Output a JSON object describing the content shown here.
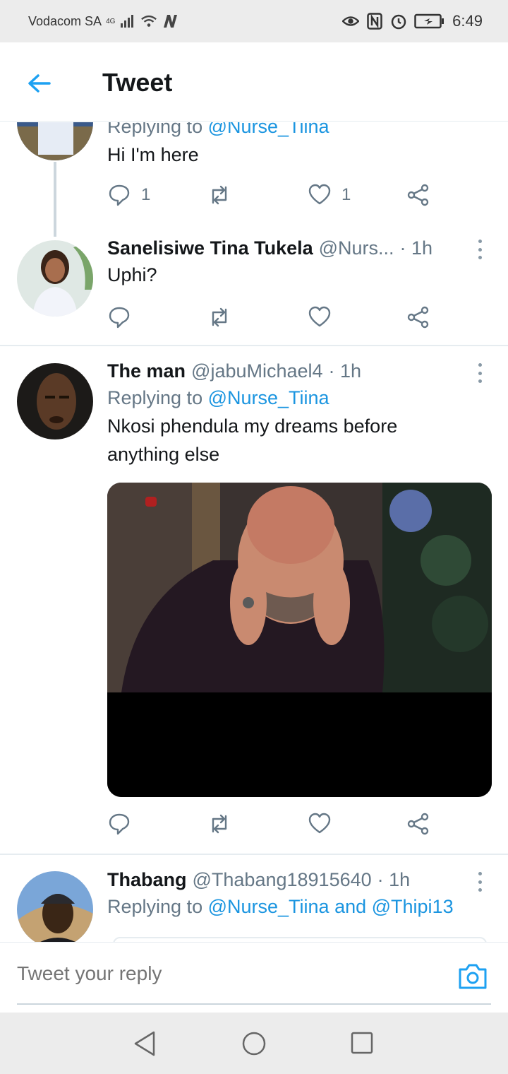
{
  "status_bar": {
    "carrier": "Vodacom SA",
    "network": "4G",
    "time": "6:49"
  },
  "header": {
    "title": "Tweet"
  },
  "tweets": [
    {
      "reply_prefix": "Replying to",
      "mention": "@Nurse_Tiina",
      "text": "Hi I'm here",
      "reply_count": "1",
      "like_count": "1"
    },
    {
      "name": "Sanelisiwe Tina Tukela",
      "handle": "@Nurs...",
      "time": "· 1h",
      "text": "Uphi?"
    },
    {
      "name": "The man",
      "handle": "@jabuMichael4",
      "time": "· 1h",
      "reply_prefix": "Replying to",
      "mention": "@Nurse_Tiina",
      "text": "Nkosi phendula my dreams before anything else"
    },
    {
      "name": "Thabang",
      "handle": "@Thabang18915640",
      "time": "· 1h",
      "reply_prefix": "Replying to",
      "mention": "@Nurse_Tiina and @Thipi13"
    }
  ],
  "reply_bar": {
    "placeholder": "Tweet your reply"
  },
  "colors": {
    "accent": "#1da1f2",
    "link": "#1b95e0",
    "muted": "#657786"
  },
  "icons": [
    "back-arrow-icon",
    "reply-icon",
    "retweet-icon",
    "like-icon",
    "share-icon",
    "more-icon",
    "camera-icon",
    "nav-back-icon",
    "nav-home-icon",
    "nav-recents-icon"
  ]
}
